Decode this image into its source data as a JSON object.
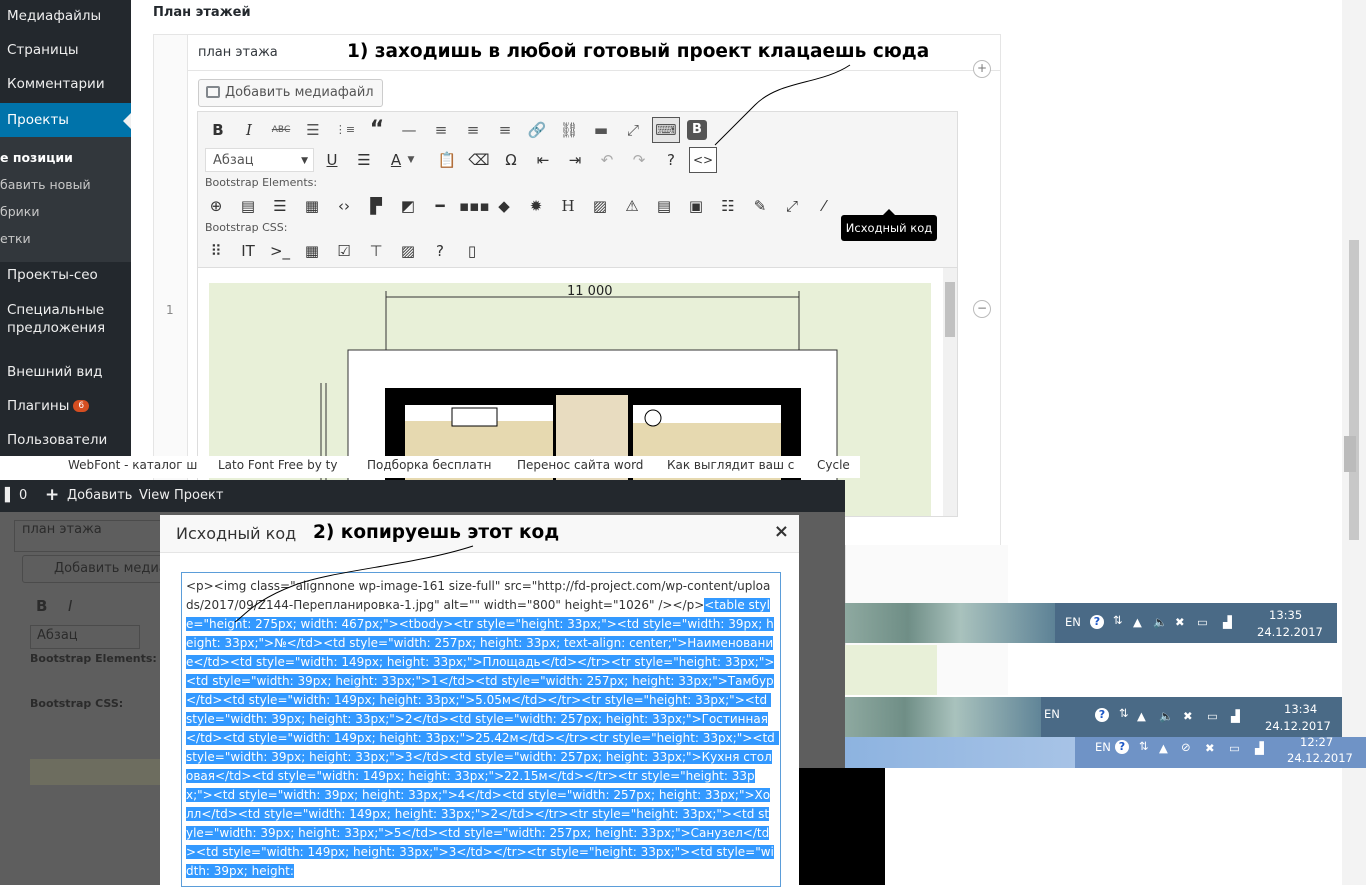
{
  "sidebar": {
    "items": [
      {
        "label": "Медиафайлы"
      },
      {
        "label": "Страницы"
      },
      {
        "label": "Комментарии"
      },
      {
        "label": "Проекты"
      },
      {
        "label": "Проекты-сео"
      },
      {
        "label": "Специальные предложения"
      },
      {
        "label": "Внешний вид"
      },
      {
        "label": "Плагины",
        "badge": "6"
      },
      {
        "label": "Пользователи"
      }
    ],
    "submenu": [
      "е позиции",
      "бавить новый",
      "брики",
      "етки"
    ]
  },
  "editor": {
    "section_title": "План этажей",
    "field_value": "план этажа",
    "add_media": "Добавить медиафайл",
    "format_select": "Абзац",
    "bootstrap_elements_label": "Bootstrap Elements:",
    "bootstrap_css_label": "Bootstrap CSS:",
    "row_number": "1",
    "tooltip": "Исходный код",
    "plan_dimension": "11 000"
  },
  "annotations": {
    "step1": "1) заходишь в любой готовый проект клацаешь сюда",
    "step2": "2) копируешь этот код"
  },
  "bookmarks": [
    "WebFont - каталог ш",
    "Lato Font Free by ty",
    "Подборка бесплатн",
    "Перенос сайта word",
    "Как выглядит ваш с",
    "Cycle"
  ],
  "adminbar": {
    "count": "0",
    "add": "Добавить",
    "view": "View Проект"
  },
  "background_editor": {
    "field_value": "план этажа",
    "add_media": "Добавить медиаф",
    "format_select": "Абзац",
    "bootstrap_elements_label": "Bootstrap Elements:",
    "bootstrap_css_label": "Bootstrap CSS:"
  },
  "modal": {
    "title": "Исходный код",
    "close": "×",
    "code_plain": "<p><img class=\"alignnone wp-image-161 size-full\" src=\"http://fd-project.com/wp-content/uploads/2017/09/Z144-Перепланировка-1.jpg\" alt=\"\" width=\"800\" height=\"1026\" /></p>",
    "code_selected": "<table style=\"height: 275px; width: 467px;\"><tbody><tr style=\"height: 33px;\"><td style=\"width: 39px; height: 33px;\">№</td><td style=\"width: 257px; height: 33px; text-align: center;\">Наименование</td><td style=\"width: 149px; height: 33px;\">Площадь</td></tr><tr style=\"height: 33px;\"><td style=\"width: 39px; height: 33px;\">1</td><td style=\"width: 257px; height: 33px;\">Тамбур</td><td style=\"width: 149px; height: 33px;\">5.05м</td></tr><tr style=\"height: 33px;\"><td style=\"width: 39px; height: 33px;\">2</td><td style=\"width: 257px; height: 33px;\">Гостинная</td><td style=\"width: 149px; height: 33px;\">25.42м</td></tr><tr style=\"height: 33px;\"><td style=\"width: 39px; height: 33px;\">3</td><td style=\"width: 257px; height: 33px;\">Кухня столовая</td><td style=\"width: 149px; height: 33px;\">22.15м</td></tr><tr style=\"height: 33px;\"><td style=\"width: 39px; height: 33px;\">4</td><td style=\"width: 257px; height: 33px;\">Холл</td><td style=\"width: 149px; height: 33px;\">2</td></tr><tr style=\"height: 33px;\"><td style=\"width: 39px; height: 33px;\">5</td><td style=\"width: 257px; height: 33px;\">Санузел</td><td style=\"width: 149px; height: 33px;\">3</td></tr><tr style=\"height: 33px;\"><td style=\"width: 39px; height:"
  },
  "taskbars": [
    {
      "lang": "EN",
      "time": "13:35",
      "date": "24.12.2017"
    },
    {
      "lang": "EN",
      "time": "13:34",
      "date": "24.12.2017"
    },
    {
      "lang": "EN",
      "time": "12:27",
      "date": "24.12.2017"
    }
  ]
}
